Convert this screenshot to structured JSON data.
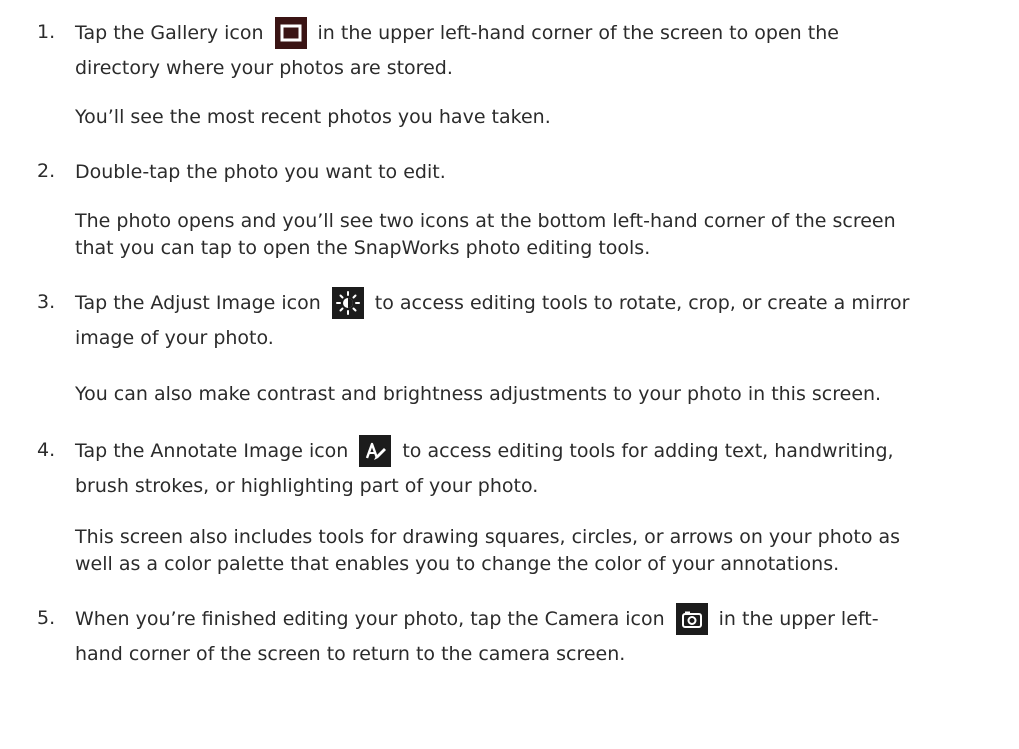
{
  "steps": [
    {
      "number": "1.",
      "line1_before": "Tap the Gallery icon",
      "line1_after": "in the upper left-hand corner of the screen to open the",
      "line2": "directory where your photos are stored.",
      "note": "You’ll see the most recent photos you have taken.",
      "icon": "gallery-icon"
    },
    {
      "number": "2.",
      "line1": "Double-tap the photo you want to edit.",
      "note_line1": "The photo opens and you’ll see two icons at the bottom left-hand corner of the screen",
      "note_line2": "that you can tap to open the SnapWorks photo editing tools."
    },
    {
      "number": "3.",
      "line1_before": "Tap the Adjust Image icon",
      "line1_after": "to access editing tools to rotate, crop, or create a mirror",
      "line2": "image of your photo.",
      "note": "You can also make contrast and brightness adjustments to your photo in this screen.",
      "icon": "adjust-image-icon"
    },
    {
      "number": "4.",
      "line1_before": "Tap the Annotate Image icon",
      "line1_after": "to access editing tools for adding text, handwriting,",
      "line2": "brush strokes, or highlighting part of your photo.",
      "note_line1": "This screen also includes tools for drawing squares, circles, or arrows on your photo as",
      "note_line2": "well as a color palette that enables you to change the color of your annotations.",
      "icon": "annotate-image-icon"
    },
    {
      "number": "5.",
      "line1_before": "When you’re finished editing your photo, tap the Camera icon",
      "line1_after": "in the upper left-",
      "line2": "hand corner of the screen to return to the camera screen.",
      "icon": "camera-icon"
    }
  ],
  "colors": {
    "text": "#2b2b2b",
    "icon_bg": "#1c1c1c",
    "gallery_icon_bg": "#3a1414"
  }
}
